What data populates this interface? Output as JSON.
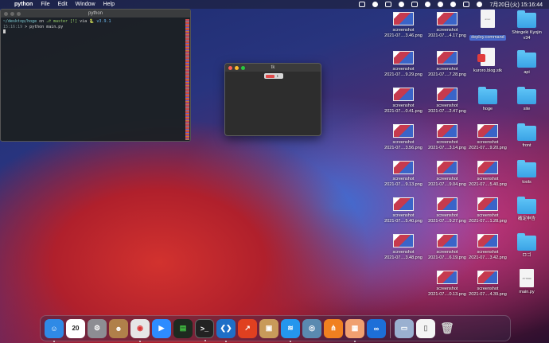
{
  "menubar": {
    "app_name": "python",
    "menus": [
      "File",
      "Edit",
      "Window",
      "Help"
    ],
    "clock": "7月20日(火) 15:16:44"
  },
  "terminal": {
    "title": "python",
    "line1_path": "~/desktop/hoge",
    "line1_on": "on",
    "line1_branch": "master [!]",
    "line1_via": "via",
    "line1_version": "v3.9.1",
    "line2_time": "15:16:19",
    "line2_cmd": "> python main.py"
  },
  "tk_window": {
    "title": "tk"
  },
  "desktop": {
    "col_c": [
      {
        "line1": "screenshot",
        "line2": "2021-07....3.46.png"
      },
      {
        "line1": "screenshot",
        "line2": "2021-07....9.29.png"
      },
      {
        "line1": "screenshot",
        "line2": "2021-07....0.41.png"
      },
      {
        "line1": "screenshot",
        "line2": "2021-07....3.56.png"
      },
      {
        "line1": "screenshot",
        "line2": "2021-07....9.13.png"
      },
      {
        "line1": "screenshot",
        "line2": "2021-07....5.40.png"
      },
      {
        "line1": "screenshot",
        "line2": "2021-07....3.48.png"
      }
    ],
    "col_b": [
      {
        "line1": "screenshot",
        "line2": "2021-07....4.17.png"
      },
      {
        "line1": "screenshot",
        "line2": "2021-07....7.28.png"
      },
      {
        "line1": "screenshot",
        "line2": "2021-07....2.47.png"
      },
      {
        "line1": "screenshot",
        "line2": "2021-07....3.14.png"
      },
      {
        "line1": "screenshot",
        "line2": "2021-07....9.04.png"
      },
      {
        "line1": "screenshot",
        "line2": "2021-07....9.27.png"
      },
      {
        "line1": "screenshot",
        "line2": "2021-07....6.19.png"
      },
      {
        "line1": "screenshot",
        "line2": "2021-07....0.13.png"
      }
    ],
    "col_a": {
      "deploy": "deploy.command",
      "kuroro": "kuroro.blog.stk",
      "hoge": "hoge",
      "shots": [
        {
          "line1": "screenshot",
          "line2": "2021-07....9.20.png"
        },
        {
          "line1": "screenshot",
          "line2": "2021-07....5.40.png"
        },
        {
          "line1": "screenshot",
          "line2": "2021-07....1.28.png"
        },
        {
          "line1": "screenshot",
          "line2": "2021-07....3.42.png"
        },
        {
          "line1": "screenshot",
          "line2": "2021-07....4.39.png"
        }
      ]
    },
    "col_far": {
      "shingeki_1": "Shingeki Kyojin",
      "shingeki_2": "v34",
      "api": "api",
      "site": "site",
      "front": "front",
      "tools": "tools",
      "kakutei": "確定申告",
      "logo": "ロゴ",
      "main_py": "main.py"
    }
  },
  "colors": {
    "folder": "#3aa3e6",
    "menubar": "#1e1e2d",
    "terminal_bg": "#1c2022"
  }
}
